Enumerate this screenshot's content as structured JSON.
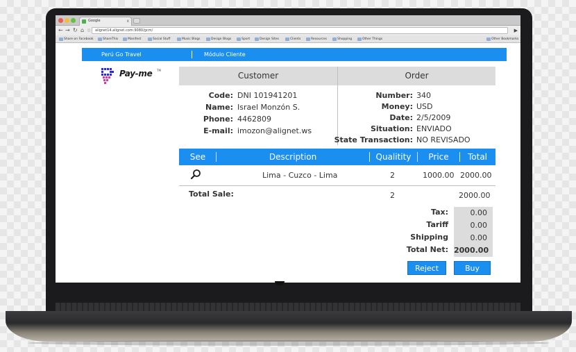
{
  "browser": {
    "tab_title": "Google",
    "tab_close": "x",
    "url": "alignet14.alignet.com:9080/gcm/",
    "bookmarks": [
      "Share on Facebook",
      "ShareThis",
      "Manifest",
      "Social Stuff",
      "Music Blogs",
      "Design Blogs",
      "Sport",
      "Design Sites",
      "Clients",
      "Resources",
      "Shopping",
      "Other Things"
    ],
    "other_bookmarks": "Other Bookmarks"
  },
  "nav": {
    "site": "Perú Go Travel",
    "module": "Módulo Cliente"
  },
  "brand": {
    "name": "Pay-me",
    "mark": "TM",
    "accent": "#1b8ff0"
  },
  "customer": {
    "heading": "Customer",
    "rows": [
      {
        "label": "Code:",
        "value": "DNI 101941201"
      },
      {
        "label": "Name:",
        "value": "Israel Monzón S."
      },
      {
        "label": "Phone:",
        "value": "4462809"
      },
      {
        "label": "E-mail:",
        "value": "imozon@alignet.ws"
      }
    ]
  },
  "order": {
    "heading": "Order",
    "rows": [
      {
        "label": "Number:",
        "value": "340"
      },
      {
        "label": "Money:",
        "value": "USD"
      },
      {
        "label": "Date:",
        "value": "2/5/2009"
      },
      {
        "label": "Situation:",
        "value": "ENVIADO"
      },
      {
        "label": "State Transaction:",
        "value": "NO REVISADO"
      }
    ]
  },
  "table": {
    "columns": [
      "See",
      "Description",
      "Qualitity",
      "Price",
      "Total"
    ],
    "rows": [
      {
        "see_icon": "magnifier-icon",
        "description": "Lima - Cuzco - Lima",
        "qty": "2",
        "price": "1000.00",
        "total": "2000.00"
      }
    ],
    "total_sale_label": "Total Sale:",
    "total_sale_qty": "2",
    "total_sale_amount": "2000.00"
  },
  "totals": [
    {
      "label": "Tax:",
      "value": "0.00"
    },
    {
      "label": "Tariff",
      "value": "0.00"
    },
    {
      "label": "Shipping",
      "value": "0.00"
    },
    {
      "label": "Total Net:",
      "value": "2000.00"
    }
  ],
  "actions": {
    "reject": "Reject",
    "buy": "Buy"
  }
}
